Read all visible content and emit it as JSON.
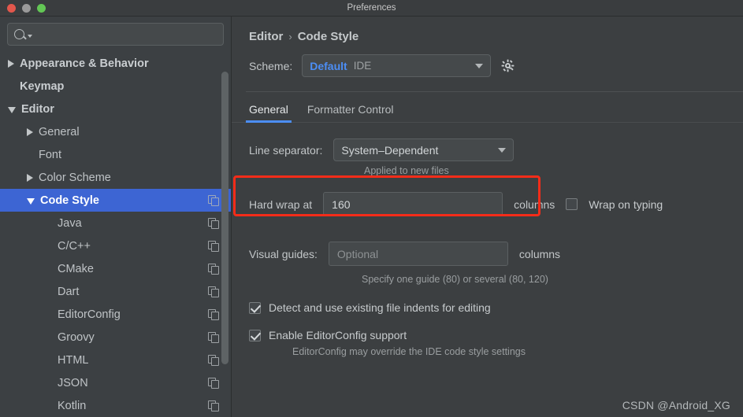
{
  "window": {
    "title": "Preferences",
    "traffic_lights": [
      "close-button",
      "minimize-button",
      "zoom-button"
    ]
  },
  "sidebar": {
    "search": {
      "value": "",
      "placeholder": ""
    },
    "items": [
      {
        "label": "Appearance & Behavior",
        "arrow": "right",
        "depth": 0,
        "bold": true,
        "selected": false,
        "copy_icon": false
      },
      {
        "label": "Keymap",
        "arrow": "none",
        "depth": 0,
        "bold": true,
        "selected": false,
        "copy_icon": false
      },
      {
        "label": "Editor",
        "arrow": "down",
        "depth": 0,
        "bold": true,
        "selected": false,
        "copy_icon": false
      },
      {
        "label": "General",
        "arrow": "right",
        "depth": 1,
        "bold": false,
        "selected": false,
        "copy_icon": false
      },
      {
        "label": "Font",
        "arrow": "none",
        "depth": 1,
        "bold": false,
        "selected": false,
        "copy_icon": false
      },
      {
        "label": "Color Scheme",
        "arrow": "right",
        "depth": 1,
        "bold": false,
        "selected": false,
        "copy_icon": false
      },
      {
        "label": "Code Style",
        "arrow": "down",
        "depth": 1,
        "bold": false,
        "selected": true,
        "copy_icon": true
      },
      {
        "label": "Java",
        "arrow": "none",
        "depth": 2,
        "bold": false,
        "selected": false,
        "copy_icon": true
      },
      {
        "label": "C/C++",
        "arrow": "none",
        "depth": 2,
        "bold": false,
        "selected": false,
        "copy_icon": true
      },
      {
        "label": "CMake",
        "arrow": "none",
        "depth": 2,
        "bold": false,
        "selected": false,
        "copy_icon": true
      },
      {
        "label": "Dart",
        "arrow": "none",
        "depth": 2,
        "bold": false,
        "selected": false,
        "copy_icon": true
      },
      {
        "label": "EditorConfig",
        "arrow": "none",
        "depth": 2,
        "bold": false,
        "selected": false,
        "copy_icon": true
      },
      {
        "label": "Groovy",
        "arrow": "none",
        "depth": 2,
        "bold": false,
        "selected": false,
        "copy_icon": true
      },
      {
        "label": "HTML",
        "arrow": "none",
        "depth": 2,
        "bold": false,
        "selected": false,
        "copy_icon": true
      },
      {
        "label": "JSON",
        "arrow": "none",
        "depth": 2,
        "bold": false,
        "selected": false,
        "copy_icon": true
      },
      {
        "label": "Kotlin",
        "arrow": "none",
        "depth": 2,
        "bold": false,
        "selected": false,
        "copy_icon": true
      }
    ]
  },
  "main": {
    "breadcrumb": {
      "parent": "Editor",
      "separator": "›",
      "current": "Code Style"
    },
    "scheme": {
      "label": "Scheme:",
      "name": "Default",
      "suffix": "IDE",
      "gear_icon": "gear-icon"
    },
    "tabs": [
      {
        "label": "General",
        "active": true
      },
      {
        "label": "Formatter Control",
        "active": false
      }
    ],
    "line_separator": {
      "label": "Line separator:",
      "value": "System–Dependent",
      "hint": "Applied to new files"
    },
    "hard_wrap": {
      "label": "Hard wrap at",
      "value": "160",
      "unit": "columns",
      "wrap_on_typing": {
        "label": "Wrap on typing",
        "checked": false
      }
    },
    "visual_guides": {
      "label": "Visual guides:",
      "value": "",
      "placeholder": "Optional",
      "unit": "columns",
      "hint": "Specify one guide (80) or several (80, 120)"
    },
    "checkboxes": [
      {
        "label": "Detect and use existing file indents for editing",
        "checked": true,
        "sub": ""
      },
      {
        "label": "Enable EditorConfig support",
        "checked": true,
        "sub": "EditorConfig may override the IDE code style settings"
      }
    ]
  },
  "watermark": "CSDN @Android_XG",
  "colors": {
    "accent_blue": "#4c8ef5",
    "selection_blue": "#3d65d3",
    "highlight_red": "#f52c19",
    "panel_bg": "#3c3f41",
    "sidebar_bg": "#3c4043"
  }
}
